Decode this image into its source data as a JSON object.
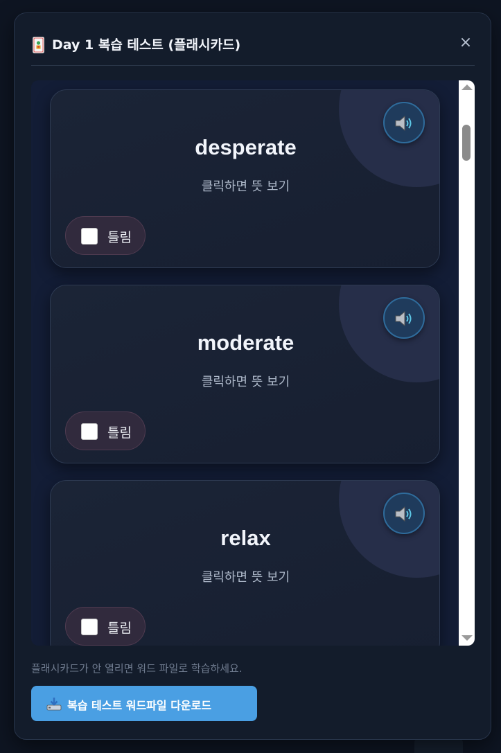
{
  "modal": {
    "title": "Day 1 복습 테스트 (플래시카드)",
    "title_icon": "flashcard-icon",
    "close_label": "×"
  },
  "cards": [
    {
      "word": "desperate",
      "hint": "클릭하면 뜻 보기",
      "wrong_label": "틀림",
      "wrong_checked": false
    },
    {
      "word": "moderate",
      "hint": "클릭하면 뜻 보기",
      "wrong_label": "틀림",
      "wrong_checked": false
    },
    {
      "word": "relax",
      "hint": "클릭하면 뜻 보기",
      "wrong_label": "틀림",
      "wrong_checked": false
    }
  ],
  "footer": {
    "note": "플래시카드가 안 열리면 워드 파일로 학습하세요.",
    "download_label": "복습 테스트 워드파일 다운로드",
    "download_icon": "download-icon"
  },
  "colors": {
    "accent": "#4a9fe3",
    "background": "#131c2b",
    "card": "#1b2436",
    "wrong_toggle": "#312a3d"
  }
}
